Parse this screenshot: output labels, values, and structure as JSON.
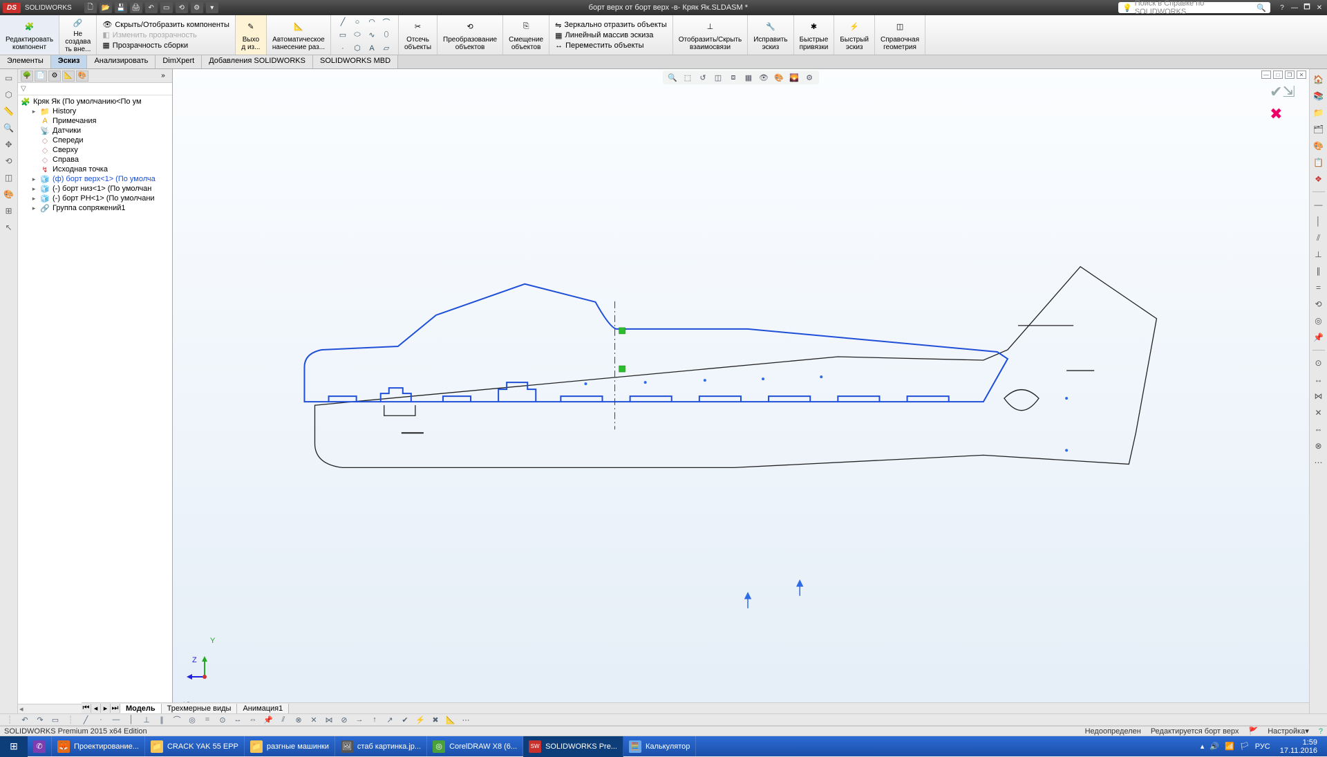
{
  "app": {
    "logo": "DS",
    "brand": "SOLIDWORKS",
    "title": "борт верх от борт верх -в- Кряк Як.SLDASM *"
  },
  "search": {
    "placeholder": "Поиск в Справке по SOLIDWORKS"
  },
  "ribbon": {
    "edit_component": "Редактировать\nкомпонент",
    "no_external": "Не\nсоздава\nть вне...",
    "hide_show": "Скрыть/Отобразить компоненты",
    "change_opacity": "Изменить прозрачность",
    "asm_opacity": "Прозрачность сборки",
    "exit_sketch": "Выхо\nд из...",
    "auto_dim": "Автоматическое\nнанесение раз...",
    "trim": "Отсечь\nобъекты",
    "convert": "Преобразование\nобъектов",
    "offset": "Смещение\nобъектов",
    "mirror": "Зеркально отразить объекты",
    "linear": "Линейный массив эскиза",
    "move": "Переместить объекты",
    "showhide_rel": "Отобразить/Скрыть\nвзаимосвязи",
    "repair": "Исправить\nэскиз",
    "quick_snaps": "Быстрые\nпривязки",
    "rapid_sketch": "Быстрый\nэскиз",
    "ref_geom": "Справочная\nгеометрия"
  },
  "tabs": {
    "items": [
      "Элементы",
      "Эскиз",
      "Анализировать",
      "DimXpert",
      "Добавления SOLIDWORKS",
      "SOLIDWORKS MBD"
    ],
    "active": 1
  },
  "tree": {
    "root": "Кряк Як  (По умолчанию<По ум",
    "history": "History",
    "annotations": "Примечания",
    "sensors": "Датчики",
    "front": "Спереди",
    "top": "Сверху",
    "right": "Справа",
    "origin": "Исходная точка",
    "p1": "(ф) борт верх<1>  (По умолча",
    "p2": "(-) борт низ<1>  (По умолчан",
    "p3": "(-) борт РН<1>  (По умолчани",
    "mates": "Группа сопряжений1"
  },
  "viewport": {
    "view_label": "*Справа",
    "axis_y": "Y",
    "axis_z": "Z"
  },
  "bottom_tabs": {
    "model": "Модель",
    "views3d": "Трехмерные виды",
    "anim": "Анимация1"
  },
  "status": {
    "edition": "SOLIDWORKS Premium 2015 x64 Edition",
    "under": "Недоопределен",
    "editing": "Редактируется борт верх",
    "custom": "Настройка"
  },
  "taskbar": {
    "items": [
      {
        "label": "Проектирование...",
        "icon": "🦊",
        "color": "#e56b17"
      },
      {
        "label": "CRACK YAK 55 EPP",
        "icon": "📁",
        "color": "#f5c657"
      },
      {
        "label": "разгные машинки",
        "icon": "📁",
        "color": "#f5c657"
      },
      {
        "label": "стаб картинка.jp...",
        "icon": "🖼",
        "color": "#6a6a6a"
      },
      {
        "label": "CorelDRAW X8 (6...",
        "icon": "◎",
        "color": "#4aa03a"
      },
      {
        "label": "SOLIDWORKS Pre...",
        "icon": "SW",
        "color": "#c9302c"
      },
      {
        "label": "Калькулятор",
        "icon": "🧮",
        "color": "#6aa8e8"
      }
    ],
    "lang": "РУС",
    "time": "1:59",
    "date": "17.11.2016"
  }
}
